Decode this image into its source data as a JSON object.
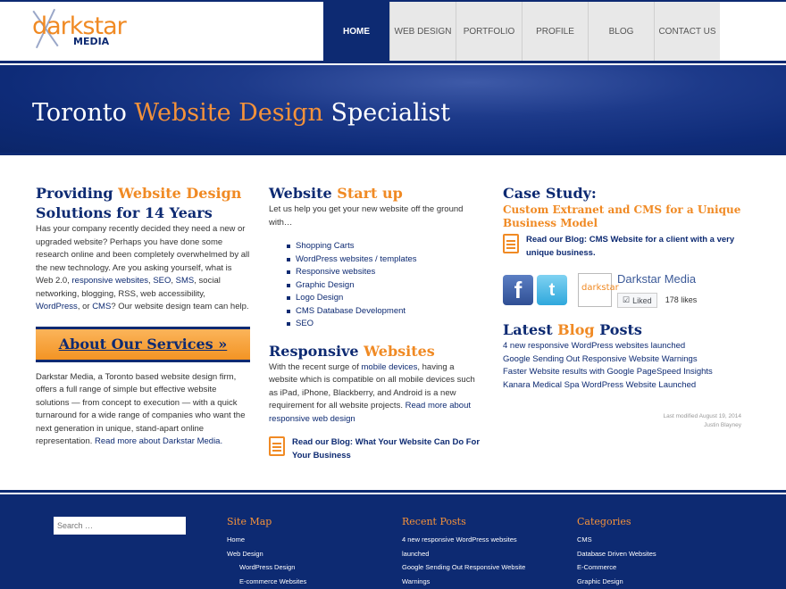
{
  "logo": {
    "word": "darkstar",
    "sub": "MEDIA"
  },
  "nav": {
    "items": [
      {
        "label": "HOME"
      },
      {
        "label": "WEB DESIGN"
      },
      {
        "label": "PORTFOLIO"
      },
      {
        "label": "PROFILE"
      },
      {
        "label": "BLOG"
      },
      {
        "label": "CONTACT US"
      }
    ]
  },
  "hero": {
    "title_start": "Toronto ",
    "title_orange": "Website Design",
    "title_end": " Specialist"
  },
  "col1": {
    "heading_start": "Providing ",
    "heading_orange": "Website Design",
    "heading_end": "Solutions for 14 Years",
    "intro_1": "Has your company recently decided they need a new or upgraded website? Perhaps you have done some research online and been completely overwhelmed by all the new technology. Are you asking yourself, what is Web 2.0, ",
    "link_responsive": "responsive websites",
    "sep1": ", ",
    "link_seo": "SEO",
    "sep2": ", ",
    "link_sms": "SMS",
    "intro_2": ", social networking, blogging, RSS, web accessibility, ",
    "link_wordpress": "WordPress",
    "intro_3": ", or ",
    "link_cms": "CMS",
    "intro_4": "? Our website design team can help.",
    "services_button": "About Our Services »",
    "about_text": "Darkstar Media, a Toronto based website design firm, offers a full range of simple but effective website solutions — from concept to execution — with a quick turnaround for a wide range of companies who want the next generation in unique, stand-apart online representation. ",
    "about_link": "Read more about Darkstar Media."
  },
  "col2": {
    "heading_start": "Website ",
    "heading_orange": "Start up",
    "intro": "Let us help you get your new website off the ground with…",
    "services": [
      "Shopping Carts",
      "WordPress websites / templates",
      "Responsive websites",
      "Graphic Design",
      "Logo Design",
      "CMS Database Development",
      "SEO"
    ],
    "resp_heading_start": "Responsive ",
    "resp_heading_orange": "Websites",
    "resp_text_1": "With the recent surge of ",
    "resp_link_mobile": "mobile devices",
    "resp_text_2": ", having a website which is compatible on all mobile devices such as iPad, iPhone, Blackberry, and Android is a new requirement for all website projects. ",
    "resp_link_more": "Read more about responsive web design",
    "blog_link": "Read our Blog: What Your Website Can Do For Your Business"
  },
  "col3": {
    "heading": "Case Study:",
    "subheading": "Custom Extranet and CMS for a Unique Business Model",
    "blog_link": "Read our Blog: CMS Website for a client with a very unique business.",
    "facebook_glyph": "f",
    "twitter_glyph": "t",
    "fb_thumb_text": "darkstar",
    "fb_page_name": "Darkstar Media",
    "liked_label": "Liked",
    "like_count": "178 likes",
    "latest_heading_start": "Latest ",
    "latest_heading_orange": "Blog",
    "latest_heading_end": " Posts",
    "latest_posts": [
      "4 new responsive WordPress websites launched",
      "Google Sending Out Responsive Website Warnings",
      "Faster Website results with Google PageSpeed Insights",
      "Kanara Medical Spa WordPress Website Launched"
    ]
  },
  "modified": {
    "line1": "Last modified August 19, 2014",
    "line2": "Justin Blayney"
  },
  "footer": {
    "search_placeholder": "Search …",
    "sitemap_heading": "Site Map",
    "sitemap": [
      {
        "label": "Home",
        "sub": false
      },
      {
        "label": "Web Design",
        "sub": false
      },
      {
        "label": "WordPress Design",
        "sub": true
      },
      {
        "label": "E-commerce Websites",
        "sub": true
      }
    ],
    "recent_heading": "Recent Posts",
    "recent": [
      "4 new responsive WordPress websites",
      "launched",
      "Google Sending Out Responsive Website",
      "Warnings"
    ],
    "categories_heading": "Categories",
    "categories": [
      "CMS",
      "Database Driven Websites",
      "E-Commerce",
      "Graphic Design"
    ]
  },
  "colors": {
    "navy": "#0d2a72",
    "orange": "#f08a24"
  }
}
